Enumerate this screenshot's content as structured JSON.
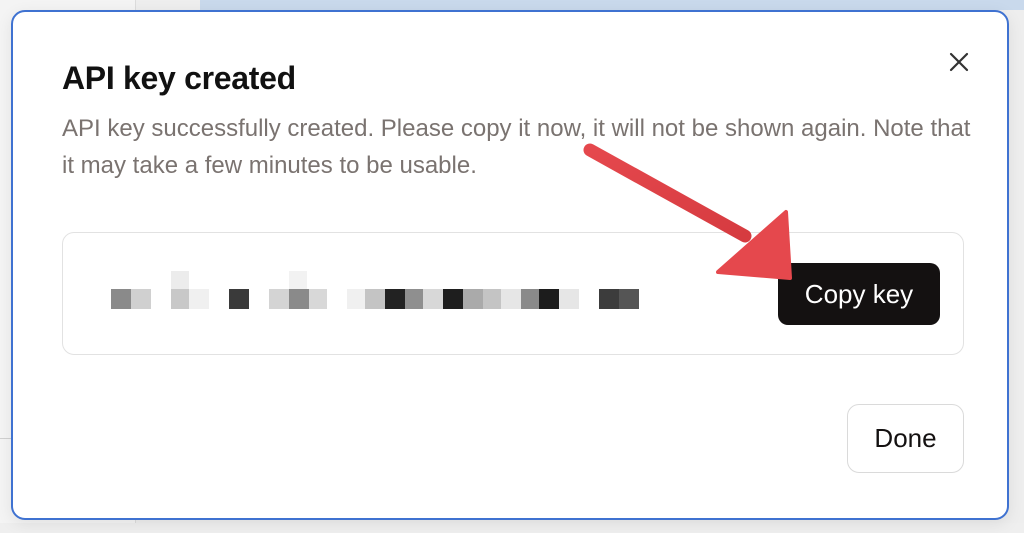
{
  "modal": {
    "title": "API key created",
    "description": "API key successfully created. Please copy it now, it will not be shown again. Note that it may take a few minutes to be usable.",
    "copy_button_label": "Copy key",
    "done_button_label": "Done",
    "close_icon": "close-icon",
    "key_value_state": "redacted-pixelated"
  },
  "annotation": {
    "arrow_color": "#e5484d",
    "points_to": "copy-key-button"
  },
  "colors": {
    "modal_border": "#3f72d1",
    "primary_button": "#141111",
    "description_text": "#7a7370"
  }
}
